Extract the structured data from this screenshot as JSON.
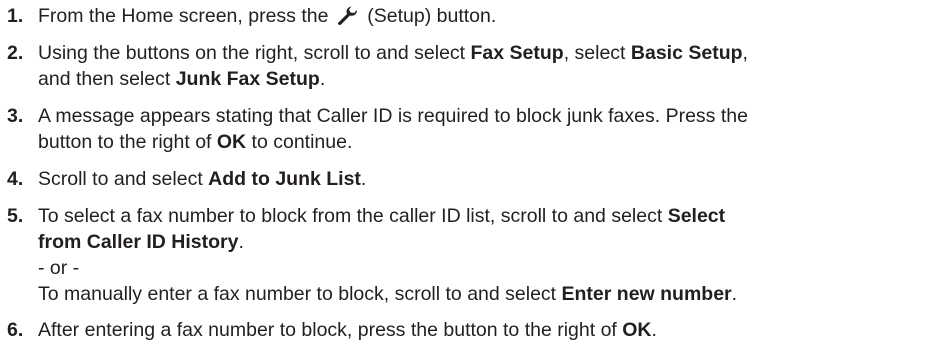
{
  "steps": [
    {
      "num": "1.",
      "parts": {
        "a": "From the Home screen, press the ",
        "icon": "wrench-icon",
        "b": " (Setup) button."
      }
    },
    {
      "num": "2.",
      "parts": {
        "a": "Using the buttons on the right, scroll to and select ",
        "b1": "Fax Setup",
        "c": ", select ",
        "b2": "Basic Setup",
        "d": ",",
        "e": "and then select ",
        "b3": "Junk Fax Setup",
        "f": "."
      }
    },
    {
      "num": "3.",
      "parts": {
        "a": "A message appears stating that Caller ID is required to block junk faxes. Press the",
        "b": "button to the right of ",
        "bold": "OK",
        "c": " to continue."
      }
    },
    {
      "num": "4.",
      "parts": {
        "a": "Scroll to and select ",
        "bold": "Add to Junk List",
        "b": "."
      }
    },
    {
      "num": "5.",
      "parts": {
        "a": "To select a fax number to block from the caller ID list, scroll to and select ",
        "bold1": "Select",
        "bold2": "from Caller ID History",
        "b": ".",
        "or": "- or -",
        "c": "To manually enter a fax number to block, scroll to and select ",
        "bold3": "Enter new number",
        "d": "."
      }
    },
    {
      "num": "6.",
      "parts": {
        "a": "After entering a fax number to block, press the button to the right of ",
        "bold": "OK",
        "b": "."
      }
    }
  ]
}
